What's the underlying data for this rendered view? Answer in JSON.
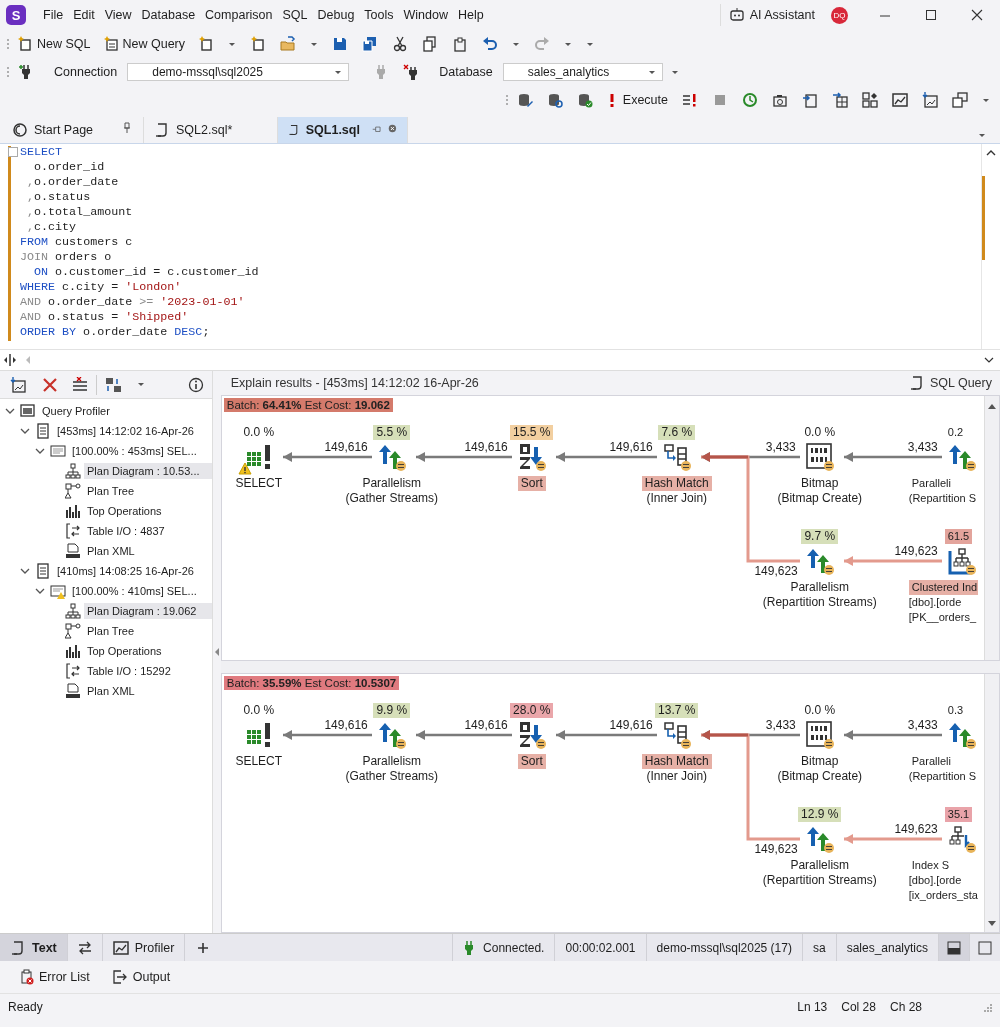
{
  "app": {
    "logo": "S",
    "menu": [
      "File",
      "Edit",
      "View",
      "Database",
      "Comparison",
      "SQL",
      "Debug",
      "Tools",
      "Window",
      "Help"
    ],
    "assistant": "AI Assistant",
    "avatar": "DQ"
  },
  "toolbar": {
    "new_sql": "New SQL",
    "new_query": "New Query"
  },
  "connection": {
    "label": "Connection",
    "value": "demo-mssql\\sql2025",
    "database_label": "Database",
    "database": "sales_analytics"
  },
  "execute": "Execute",
  "tabs": [
    {
      "label": "Start Page",
      "kind": "start",
      "selected": false
    },
    {
      "label": "SQL2.sql*",
      "kind": "sql",
      "selected": false
    },
    {
      "label": "SQL1.sql",
      "kind": "sql",
      "selected": true
    }
  ],
  "editor": {
    "lines": [
      [
        {
          "kind": "keyword",
          "text": "SELECT"
        }
      ],
      [
        {
          "kind": "plain",
          "text": "  o.order_id"
        }
      ],
      [
        {
          "kind": "gray",
          "text": " ,"
        },
        {
          "kind": "plain",
          "text": "o.order_date"
        }
      ],
      [
        {
          "kind": "gray",
          "text": " ,"
        },
        {
          "kind": "plain",
          "text": "o.status"
        }
      ],
      [
        {
          "kind": "gray",
          "text": " ,"
        },
        {
          "kind": "plain",
          "text": "o.total_amount"
        }
      ],
      [
        {
          "kind": "gray",
          "text": " ,"
        },
        {
          "kind": "plain",
          "text": "c.city"
        }
      ],
      [
        {
          "kind": "keyword",
          "text": "FROM"
        },
        {
          "kind": "plain",
          "text": " customers c"
        }
      ],
      [
        {
          "kind": "gray",
          "text": "JOIN"
        },
        {
          "kind": "plain",
          "text": " orders o"
        }
      ],
      [
        {
          "kind": "keyword",
          "text": "  ON"
        },
        {
          "kind": "plain",
          "text": " o.customer_id = c.customer_id"
        }
      ],
      [
        {
          "kind": "keyword",
          "text": "WHERE"
        },
        {
          "kind": "plain",
          "text": " c.city = "
        },
        {
          "kind": "string",
          "text": "'London'"
        }
      ],
      [
        {
          "kind": "gray",
          "text": "AND"
        },
        {
          "kind": "plain",
          "text": " o.order_date "
        },
        {
          "kind": "gray",
          "text": ">= "
        },
        {
          "kind": "string",
          "text": "'2023-01-01'"
        }
      ],
      [
        {
          "kind": "gray",
          "text": "AND"
        },
        {
          "kind": "plain",
          "text": " o.status = "
        },
        {
          "kind": "string",
          "text": "'Shipped'"
        }
      ],
      [
        {
          "kind": "keyword",
          "text": "ORDER BY"
        },
        {
          "kind": "plain",
          "text": " o.order_date "
        },
        {
          "kind": "keyword",
          "text": "DESC"
        },
        {
          "kind": "plain",
          "text": ";"
        }
      ]
    ]
  },
  "profiler": {
    "tree": [
      {
        "label": "Query Profiler",
        "kind": "profiler",
        "expanded": true,
        "selected": false,
        "children": [
          {
            "label": "[453ms] 14:12:02 16-Apr-26",
            "kind": "session",
            "expanded": true,
            "selected": false,
            "children": [
              {
                "label": "[100.00% : 453ms] SEL...",
                "kind": "sql",
                "expanded": true,
                "selected": false,
                "children": [
                  {
                    "label": "Plan Diagram : 10.53...",
                    "kind": "diagram",
                    "selected": true
                  },
                  {
                    "label": "Plan Tree",
                    "kind": "plan_tree",
                    "selected": false
                  },
                  {
                    "label": "Top Operations",
                    "kind": "bars",
                    "selected": false
                  },
                  {
                    "label": "Table I/O : 4837",
                    "kind": "io",
                    "selected": false
                  },
                  {
                    "label": "Plan XML",
                    "kind": "xml",
                    "selected": false
                  }
                ]
              }
            ]
          },
          {
            "label": "[410ms] 14:08:25 16-Apr-26",
            "kind": "session",
            "expanded": true,
            "selected": false,
            "children": [
              {
                "label": "[100.00% : 410ms] SEL...",
                "kind": "sql_warning",
                "expanded": true,
                "selected": false,
                "children": [
                  {
                    "label": "Plan Diagram : 19.062",
                    "kind": "diagram",
                    "selected": true
                  },
                  {
                    "label": "Plan Tree",
                    "kind": "plan_tree",
                    "selected": false
                  },
                  {
                    "label": "Top Operations",
                    "kind": "bars",
                    "selected": false
                  },
                  {
                    "label": "Table I/O : 15292",
                    "kind": "io",
                    "selected": false
                  },
                  {
                    "label": "Plan XML",
                    "kind": "xml",
                    "selected": false
                  }
                ]
              }
            ]
          }
        ]
      }
    ]
  },
  "explain": {
    "title": "Explain results - [453ms] 14:12:02 16-Apr-26",
    "sql_query": "SQL Query",
    "plans": [
      {
        "batch": "Batch: **64.41%** Est Cost: **19.062**",
        "color": "#d47a6b",
        "main": [
          {
            "kind": "select",
            "percent": "0.0 %",
            "name": "SELECT",
            "highlighted": false,
            "warning": true
          },
          {
            "kind": "parallelism",
            "percent": "5.5 %",
            "color": "#d6dfb9",
            "name": "Parallelism",
            "highlighted": false,
            "warning": false,
            "details": [
              "(Gather Streams)"
            ],
            "rows": "149,616",
            "heavy": false
          },
          {
            "kind": "sort",
            "percent": "15.5 %",
            "color": "#f2cfa0",
            "name": "Sort",
            "highlighted": true,
            "warning": false,
            "rows": "149,616",
            "heavy": false
          },
          {
            "kind": "hash",
            "percent": "7.6 %",
            "color": "#d6dfb9",
            "name": "Hash Match",
            "highlighted": true,
            "warning": false,
            "details": [
              "(Inner Join)"
            ],
            "rows": "149,616",
            "heavy": false
          },
          {
            "kind": "bitmap",
            "percent": "0.0 %",
            "name": "Bitmap",
            "highlighted": false,
            "warning": false,
            "details": [
              "(Bitmap Create)"
            ],
            "rows": "3,433",
            "heavy": false
          },
          {
            "kind": "parallelism",
            "percent": "0.2",
            "name": "Paralleli",
            "highlighted": false,
            "warning": false,
            "details": [
              "(Repartition S"
            ],
            "rows": "3,433",
            "heavy": false
          }
        ],
        "branch": [
          {
            "kind": "parallelism",
            "percent": "9.7 %",
            "color": "#d6dfb9",
            "name": "Parallelism",
            "highlighted": false,
            "warning": false,
            "details": [
              "(Repartition Streams)"
            ],
            "rows": "149,623",
            "heavy": true
          },
          {
            "kind": "clustered_index",
            "percent": "61.5",
            "color": "#e3a49c",
            "name": "Clustered Ind",
            "highlighted": true,
            "warning": false,
            "details": [
              "[dbo].[orde",
              "[PK__orders_"
            ],
            "rows": "149,623",
            "heavy": true
          }
        ]
      },
      {
        "batch": "Batch: **35.59%** Est Cost: **10.5307**",
        "color": "#e07a7f",
        "main": [
          {
            "kind": "select",
            "percent": "0.0 %",
            "name": "SELECT",
            "highlighted": false,
            "warning": false
          },
          {
            "kind": "parallelism",
            "percent": "9.9 %",
            "color": "#d6dfb9",
            "name": "Parallelism",
            "highlighted": false,
            "warning": false,
            "details": [
              "(Gather Streams)"
            ],
            "rows": "149,616",
            "heavy": false
          },
          {
            "kind": "sort",
            "percent": "28.0 %",
            "color": "#eaa6aa",
            "name": "Sort",
            "highlighted": true,
            "warning": false,
            "rows": "149,616",
            "heavy": false
          },
          {
            "kind": "hash",
            "percent": "13.7 %",
            "color": "#d6dfb9",
            "name": "Hash Match",
            "highlighted": true,
            "warning": false,
            "details": [
              "(Inner Join)"
            ],
            "rows": "149,616",
            "heavy": false
          },
          {
            "kind": "bitmap",
            "percent": "0.0 %",
            "name": "Bitmap",
            "highlighted": false,
            "warning": false,
            "details": [
              "(Bitmap Create)"
            ],
            "rows": "3,433",
            "heavy": false
          },
          {
            "kind": "parallelism",
            "percent": "0.3",
            "name": "Paralleli",
            "highlighted": false,
            "warning": false,
            "details": [
              "(Repartition S"
            ],
            "rows": "3,433",
            "heavy": false
          }
        ],
        "branch": [
          {
            "kind": "parallelism",
            "percent": "12.9 %",
            "color": "#d6dfb9",
            "name": "Parallelism",
            "highlighted": false,
            "warning": false,
            "details": [
              "(Repartition Streams)"
            ],
            "rows": "149,623",
            "heavy": true
          },
          {
            "kind": "index_seek",
            "percent": "35.1",
            "color": "#e9a3a9",
            "name": "Index S",
            "highlighted": false,
            "warning": false,
            "details": [
              "[dbo].[orde",
              "[ix_orders_sta"
            ],
            "rows": "149,623",
            "heavy": true
          }
        ]
      }
    ]
  },
  "bottom_tabs": [
    {
      "label": "Text",
      "kind": "text",
      "selected": true
    },
    {
      "kind": "compare",
      "selected": false
    },
    {
      "label": "Profiler",
      "kind": "profiler",
      "selected": false
    }
  ],
  "connection_status": {
    "state": "Connected.",
    "elapsed": "00:00:02.001",
    "server": "demo-mssql\\sql2025 (17)",
    "user": "sa",
    "database": "sales_analytics"
  },
  "output_tabs": [
    {
      "label": "Error List",
      "kind": "errors"
    },
    {
      "label": "Output",
      "kind": "output"
    }
  ],
  "status_bar": {
    "message": "Ready",
    "line": "Ln 13",
    "column": "Col 28",
    "char": "Ch 28"
  }
}
